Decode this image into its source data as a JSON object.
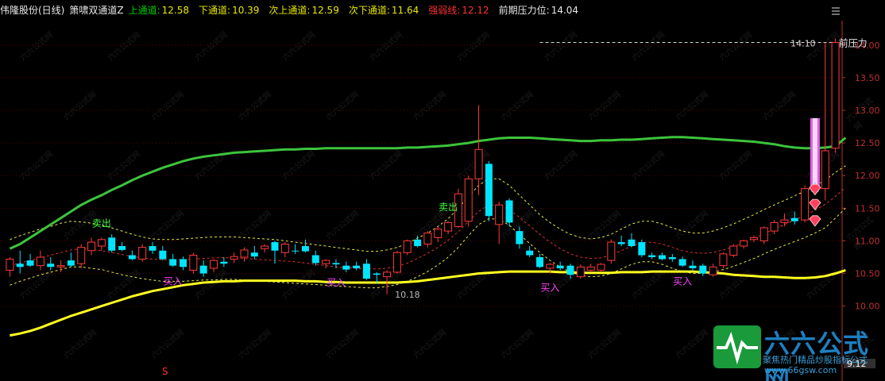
{
  "header": {
    "stock": "伟隆股份(日线)",
    "indicator": "箫啸双通道Z",
    "items": [
      {
        "label": "上通道:",
        "value": "12.58",
        "color": "#e8e800"
      },
      {
        "label": "下通道:",
        "value": "10.39",
        "color": "#e8e800"
      },
      {
        "label": "次上通道:",
        "value": "12.59",
        "color": "#e8e800"
      },
      {
        "label": "次下通道:",
        "value": "11.64",
        "color": "#e8e800"
      },
      {
        "label": "强弱线:",
        "value": "12.12",
        "color": "#ff3030"
      },
      {
        "label": "前期压力位:",
        "value": "14.04",
        "color": "#e8e8e8"
      }
    ],
    "label_color_upper": "#00d000",
    "menu_icon": "hamburger-menu-icon"
  },
  "chart_data": {
    "type": "candlestick",
    "ylim": [
      9.12,
      14.35
    ],
    "y_ticks": [
      "10.00",
      "10.50",
      "11.00",
      "11.50",
      "12.00",
      "12.50",
      "13.00",
      "13.50",
      "14.00"
    ],
    "current_price_label": "9.12",
    "resistance": {
      "value": 14.04,
      "label": "14.10",
      "text": "前压力"
    },
    "low_marker": "10.18",
    "candles": [
      {
        "o": 10.55,
        "h": 10.75,
        "l": 10.45,
        "c": 10.72
      },
      {
        "o": 10.65,
        "h": 10.85,
        "l": 10.5,
        "c": 10.6
      },
      {
        "o": 10.7,
        "h": 10.8,
        "l": 10.6,
        "c": 10.62
      },
      {
        "o": 10.62,
        "h": 10.85,
        "l": 10.55,
        "c": 10.75
      },
      {
        "o": 10.65,
        "h": 10.75,
        "l": 10.55,
        "c": 10.6
      },
      {
        "o": 10.6,
        "h": 10.7,
        "l": 10.52,
        "c": 10.62
      },
      {
        "o": 10.7,
        "h": 10.82,
        "l": 10.6,
        "c": 10.62
      },
      {
        "o": 10.65,
        "h": 10.95,
        "l": 10.58,
        "c": 10.9
      },
      {
        "o": 10.85,
        "h": 11.05,
        "l": 10.78,
        "c": 10.98
      },
      {
        "o": 10.92,
        "h": 11.05,
        "l": 10.85,
        "c": 11.02
      },
      {
        "o": 11.05,
        "h": 11.1,
        "l": 10.82,
        "c": 10.85
      },
      {
        "o": 10.92,
        "h": 10.98,
        "l": 10.84,
        "c": 10.86
      },
      {
        "o": 10.78,
        "h": 10.85,
        "l": 10.7,
        "c": 10.72
      },
      {
        "o": 10.72,
        "h": 10.95,
        "l": 10.68,
        "c": 10.9
      },
      {
        "o": 10.92,
        "h": 10.98,
        "l": 10.8,
        "c": 10.85
      },
      {
        "o": 10.85,
        "h": 10.92,
        "l": 10.7,
        "c": 10.72
      },
      {
        "o": 10.72,
        "h": 10.8,
        "l": 10.6,
        "c": 10.62
      },
      {
        "o": 10.72,
        "h": 10.76,
        "l": 10.55,
        "c": 10.6
      },
      {
        "o": 10.55,
        "h": 10.82,
        "l": 10.5,
        "c": 10.78
      },
      {
        "o": 10.62,
        "h": 10.7,
        "l": 10.45,
        "c": 10.5
      },
      {
        "o": 10.58,
        "h": 10.72,
        "l": 10.52,
        "c": 10.7
      },
      {
        "o": 10.68,
        "h": 10.75,
        "l": 10.6,
        "c": 10.65
      },
      {
        "o": 10.72,
        "h": 10.82,
        "l": 10.66,
        "c": 10.76
      },
      {
        "o": 10.75,
        "h": 10.9,
        "l": 10.68,
        "c": 10.86
      },
      {
        "o": 10.82,
        "h": 10.92,
        "l": 10.72,
        "c": 10.76
      },
      {
        "o": 10.88,
        "h": 10.95,
        "l": 10.82,
        "c": 10.92
      },
      {
        "o": 10.98,
        "h": 11.0,
        "l": 10.65,
        "c": 10.85
      },
      {
        "o": 10.82,
        "h": 10.98,
        "l": 10.75,
        "c": 10.95
      },
      {
        "o": 10.85,
        "h": 10.95,
        "l": 10.8,
        "c": 10.84
      },
      {
        "o": 10.92,
        "h": 11.02,
        "l": 10.82,
        "c": 10.84
      },
      {
        "o": 10.78,
        "h": 10.85,
        "l": 10.62,
        "c": 10.66
      },
      {
        "o": 10.65,
        "h": 10.72,
        "l": 10.58,
        "c": 10.7
      },
      {
        "o": 10.66,
        "h": 10.72,
        "l": 10.58,
        "c": 10.64
      },
      {
        "o": 10.62,
        "h": 10.68,
        "l": 10.52,
        "c": 10.56
      },
      {
        "o": 10.62,
        "h": 10.68,
        "l": 10.55,
        "c": 10.58
      },
      {
        "o": 10.65,
        "h": 10.72,
        "l": 10.4,
        "c": 10.42
      },
      {
        "o": 10.5,
        "h": 10.52,
        "l": 10.35,
        "c": 10.48
      },
      {
        "o": 10.45,
        "h": 10.55,
        "l": 10.18,
        "c": 10.52
      },
      {
        "o": 10.52,
        "h": 10.85,
        "l": 10.5,
        "c": 10.82
      },
      {
        "o": 10.82,
        "h": 11.02,
        "l": 10.78,
        "c": 11.0
      },
      {
        "o": 11.02,
        "h": 11.08,
        "l": 10.9,
        "c": 10.92
      },
      {
        "o": 10.95,
        "h": 11.15,
        "l": 10.9,
        "c": 11.12
      },
      {
        "o": 11.05,
        "h": 11.22,
        "l": 10.98,
        "c": 11.18
      },
      {
        "o": 11.15,
        "h": 11.3,
        "l": 11.1,
        "c": 11.28
      },
      {
        "o": 11.22,
        "h": 11.8,
        "l": 11.2,
        "c": 11.72
      },
      {
        "o": 11.3,
        "h": 12.0,
        "l": 11.22,
        "c": 11.95
      },
      {
        "o": 11.95,
        "h": 13.08,
        "l": 11.7,
        "c": 12.4
      },
      {
        "o": 12.18,
        "h": 12.22,
        "l": 11.3,
        "c": 11.38
      },
      {
        "o": 11.25,
        "h": 11.6,
        "l": 10.95,
        "c": 11.55
      },
      {
        "o": 11.62,
        "h": 11.65,
        "l": 11.22,
        "c": 11.28
      },
      {
        "o": 11.15,
        "h": 11.22,
        "l": 10.88,
        "c": 10.95
      },
      {
        "o": 10.85,
        "h": 10.92,
        "l": 10.75,
        "c": 10.78
      },
      {
        "o": 10.75,
        "h": 10.8,
        "l": 10.58,
        "c": 10.6
      },
      {
        "o": 10.58,
        "h": 10.66,
        "l": 10.5,
        "c": 10.64
      },
      {
        "o": 10.62,
        "h": 10.68,
        "l": 10.55,
        "c": 10.58
      },
      {
        "o": 10.62,
        "h": 10.65,
        "l": 10.42,
        "c": 10.48
      },
      {
        "o": 10.45,
        "h": 10.64,
        "l": 10.42,
        "c": 10.6
      },
      {
        "o": 10.55,
        "h": 10.65,
        "l": 10.52,
        "c": 10.6
      },
      {
        "o": 10.55,
        "h": 10.66,
        "l": 10.52,
        "c": 10.64
      },
      {
        "o": 10.7,
        "h": 11.02,
        "l": 10.65,
        "c": 10.98
      },
      {
        "o": 10.98,
        "h": 11.08,
        "l": 10.92,
        "c": 10.95
      },
      {
        "o": 11.02,
        "h": 11.12,
        "l": 10.9,
        "c": 10.92
      },
      {
        "o": 10.98,
        "h": 11.02,
        "l": 10.75,
        "c": 10.78
      },
      {
        "o": 10.78,
        "h": 10.82,
        "l": 10.72,
        "c": 10.75
      },
      {
        "o": 10.78,
        "h": 10.82,
        "l": 10.7,
        "c": 10.72
      },
      {
        "o": 10.75,
        "h": 10.8,
        "l": 10.68,
        "c": 10.72
      },
      {
        "o": 10.72,
        "h": 10.76,
        "l": 10.6,
        "c": 10.62
      },
      {
        "o": 10.62,
        "h": 10.7,
        "l": 10.55,
        "c": 10.58
      },
      {
        "o": 10.62,
        "h": 10.65,
        "l": 10.46,
        "c": 10.5
      },
      {
        "o": 10.48,
        "h": 10.65,
        "l": 10.45,
        "c": 10.6
      },
      {
        "o": 10.62,
        "h": 10.82,
        "l": 10.58,
        "c": 10.8
      },
      {
        "o": 10.78,
        "h": 10.95,
        "l": 10.75,
        "c": 10.92
      },
      {
        "o": 10.92,
        "h": 11.02,
        "l": 10.88,
        "c": 11.0
      },
      {
        "o": 11.02,
        "h": 11.08,
        "l": 10.98,
        "c": 11.05
      },
      {
        "o": 11.0,
        "h": 11.22,
        "l": 10.95,
        "c": 11.2
      },
      {
        "o": 11.15,
        "h": 11.32,
        "l": 11.1,
        "c": 11.28
      },
      {
        "o": 11.28,
        "h": 11.42,
        "l": 11.22,
        "c": 11.32
      },
      {
        "o": 11.35,
        "h": 11.45,
        "l": 11.25,
        "c": 11.3
      },
      {
        "o": 11.32,
        "h": 11.85,
        "l": 11.28,
        "c": 11.8
      },
      {
        "o": 11.78,
        "h": 11.9,
        "l": 11.7,
        "c": 11.75
      },
      {
        "o": 11.8,
        "h": 14.04,
        "l": 11.62,
        "c": 12.38
      },
      {
        "o": 12.42,
        "h": 14.1,
        "l": 12.35,
        "c": 14.04
      }
    ],
    "upper_channel": [
      10.88,
      10.95,
      11.05,
      11.15,
      11.25,
      11.35,
      11.45,
      11.55,
      11.63,
      11.7,
      11.78,
      11.85,
      11.93,
      12.0,
      12.06,
      12.12,
      12.17,
      12.22,
      12.26,
      12.29,
      12.31,
      12.33,
      12.35,
      12.36,
      12.37,
      12.38,
      12.39,
      12.4,
      12.4,
      12.41,
      12.41,
      12.42,
      12.42,
      12.42,
      12.42,
      12.42,
      12.42,
      12.42,
      12.42,
      12.43,
      12.43,
      12.44,
      12.45,
      12.46,
      12.48,
      12.5,
      12.53,
      12.55,
      12.57,
      12.58,
      12.58,
      12.58,
      12.57,
      12.56,
      12.55,
      12.54,
      12.53,
      12.53,
      12.54,
      12.54,
      12.55,
      12.55,
      12.56,
      12.57,
      12.58,
      12.59,
      12.59,
      12.58,
      12.57,
      12.56,
      12.55,
      12.54,
      12.53,
      12.52,
      12.5,
      12.48,
      12.45,
      12.43,
      12.42,
      12.42,
      12.43,
      12.45,
      12.58
    ],
    "lower_channel": [
      9.55,
      9.58,
      9.62,
      9.67,
      9.73,
      9.79,
      9.85,
      9.9,
      9.95,
      10.0,
      10.05,
      10.1,
      10.15,
      10.19,
      10.23,
      10.26,
      10.29,
      10.32,
      10.34,
      10.36,
      10.37,
      10.38,
      10.38,
      10.39,
      10.39,
      10.39,
      10.39,
      10.39,
      10.39,
      10.38,
      10.38,
      10.37,
      10.37,
      10.36,
      10.36,
      10.36,
      10.36,
      10.36,
      10.36,
      10.37,
      10.38,
      10.4,
      10.42,
      10.44,
      10.46,
      10.48,
      10.5,
      10.51,
      10.52,
      10.53,
      10.53,
      10.53,
      10.53,
      10.53,
      10.52,
      10.52,
      10.51,
      10.51,
      10.51,
      10.51,
      10.52,
      10.52,
      10.52,
      10.53,
      10.53,
      10.53,
      10.53,
      10.53,
      10.52,
      10.51,
      10.5,
      10.48,
      10.47,
      10.46,
      10.45,
      10.45,
      10.44,
      10.43,
      10.43,
      10.44,
      10.46,
      10.5,
      10.55
    ],
    "sub_upper": [
      11.02,
      11.08,
      11.13,
      11.18,
      11.22,
      11.27,
      11.3,
      11.29,
      11.27,
      11.24,
      11.2,
      11.15,
      11.1,
      11.06,
      11.03,
      11.02,
      11.02,
      11.03,
      11.04,
      11.05,
      11.06,
      11.06,
      11.06,
      11.05,
      11.04,
      11.03,
      11.02,
      11.0,
      10.98,
      10.96,
      10.94,
      10.92,
      10.9,
      10.88,
      10.86,
      10.84,
      10.84,
      10.86,
      10.9,
      10.96,
      11.04,
      11.12,
      11.22,
      11.34,
      11.5,
      11.68,
      11.85,
      11.95,
      11.95,
      11.85,
      11.7,
      11.55,
      11.4,
      11.28,
      11.18,
      11.1,
      11.05,
      11.03,
      11.05,
      11.1,
      11.18,
      11.26,
      11.3,
      11.3,
      11.26,
      11.2,
      11.15,
      11.12,
      11.12,
      11.15,
      11.2,
      11.26,
      11.33,
      11.4,
      11.48,
      11.55,
      11.62,
      11.69,
      11.76,
      11.84,
      11.93,
      12.05,
      12.15
    ],
    "sub_lower": [
      10.32,
      10.38,
      10.43,
      10.48,
      10.52,
      10.56,
      10.6,
      10.6,
      10.58,
      10.56,
      10.52,
      10.48,
      10.45,
      10.42,
      10.4,
      10.38,
      10.38,
      10.38,
      10.39,
      10.4,
      10.4,
      10.41,
      10.41,
      10.4,
      10.39,
      10.38,
      10.37,
      10.36,
      10.35,
      10.34,
      10.33,
      10.32,
      10.31,
      10.3,
      10.29,
      10.28,
      10.28,
      10.3,
      10.33,
      10.38,
      10.45,
      10.53,
      10.63,
      10.75,
      10.9,
      11.08,
      11.25,
      11.34,
      11.33,
      11.24,
      11.1,
      10.96,
      10.82,
      10.7,
      10.6,
      10.52,
      10.47,
      10.45,
      10.46,
      10.5,
      10.57,
      10.64,
      10.68,
      10.68,
      10.64,
      10.58,
      10.53,
      10.5,
      10.5,
      10.52,
      10.56,
      10.61,
      10.67,
      10.73,
      10.8,
      10.87,
      10.93,
      10.99,
      11.05,
      11.12,
      11.2,
      11.35,
      11.5
    ],
    "strength_line": [
      10.62,
      10.66,
      10.7,
      10.74,
      10.78,
      10.82,
      10.86,
      10.88,
      10.87,
      10.85,
      10.82,
      10.79,
      10.76,
      10.74,
      10.72,
      10.71,
      10.71,
      10.71,
      10.72,
      10.73,
      10.74,
      10.74,
      10.74,
      10.73,
      10.72,
      10.71,
      10.7,
      10.69,
      10.68,
      10.66,
      10.64,
      10.62,
      10.6,
      10.59,
      10.58,
      10.57,
      10.57,
      10.58,
      10.61,
      10.66,
      10.73,
      10.81,
      10.9,
      11.01,
      11.14,
      11.3,
      11.45,
      11.55,
      11.55,
      11.48,
      11.36,
      11.23,
      11.1,
      10.98,
      10.88,
      10.8,
      10.75,
      10.73,
      10.74,
      10.78,
      10.85,
      10.92,
      10.97,
      10.98,
      10.95,
      10.9,
      10.85,
      10.82,
      10.81,
      10.82,
      10.86,
      10.91,
      10.97,
      11.04,
      11.11,
      11.18,
      11.25,
      11.32,
      11.39,
      11.47,
      11.56,
      11.68,
      11.82
    ],
    "signals": [
      {
        "idx": 9,
        "type": "sell",
        "text": "卖出"
      },
      {
        "idx": 16,
        "type": "buy",
        "text": "买入"
      },
      {
        "idx": 32,
        "type": "buy",
        "text": "买入"
      },
      {
        "idx": 43,
        "type": "sell",
        "text": "卖出"
      },
      {
        "idx": 53,
        "type": "buy",
        "text": "买入"
      },
      {
        "idx": 66,
        "type": "buy",
        "text": "买入"
      }
    ],
    "diamond_markers": [
      79,
      79,
      79
    ],
    "bottom_marker": "S"
  },
  "logo": {
    "name": "六六公式网",
    "slogan": "聚焦热门精品炒股指标公式",
    "url": "www.66gsw.com"
  },
  "watermark": "六六公式网",
  "colors": {
    "up": "#ff3b3b",
    "down": "#00e5ff",
    "upper_channel": "#3cc43c",
    "lower_channel": "#ffff20",
    "strength": "#e03030",
    "sub_channel": "#e8e840",
    "axis": "#c03030",
    "grid": "#5a0000"
  }
}
